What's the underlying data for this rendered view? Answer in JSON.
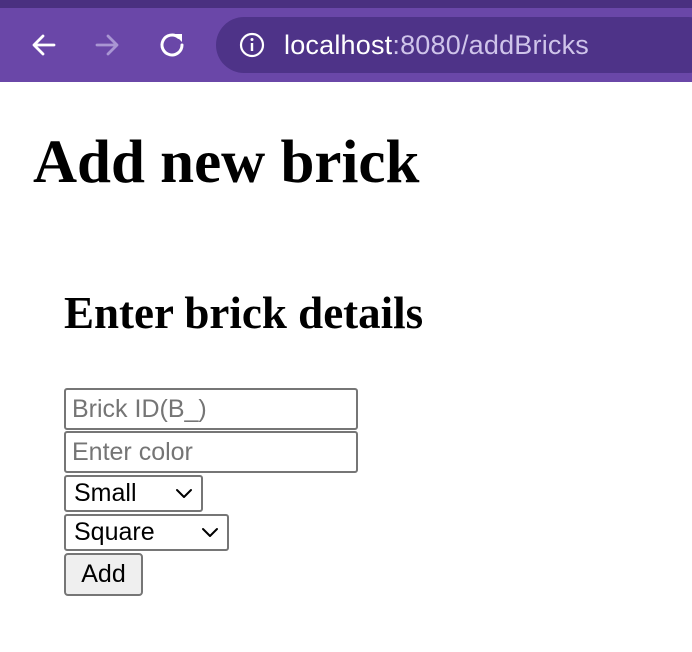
{
  "browser": {
    "url_host": "localhost",
    "url_path": ":8080/addBricks",
    "icons": [
      "back-arrow-icon",
      "forward-arrow-icon",
      "reload-icon",
      "info-icon"
    ],
    "colors": {
      "toolbar": "#6a47a8",
      "url_pill": "#4e3388",
      "url_path_text": "#cfc4ea"
    }
  },
  "page": {
    "title": "Add new brick",
    "section_title": "Enter brick details"
  },
  "form": {
    "brick_id": {
      "value": "",
      "placeholder": "Brick ID(B_)"
    },
    "color": {
      "value": "",
      "placeholder": "Enter color"
    },
    "size_select": {
      "selected": "Small"
    },
    "shape_select": {
      "selected": "Square"
    },
    "submit_label": "Add"
  }
}
